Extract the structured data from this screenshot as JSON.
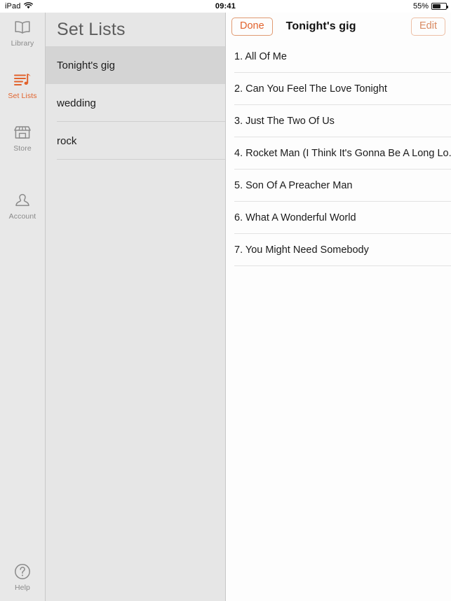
{
  "status_bar": {
    "device": "iPad",
    "wifi_icon": "wifi-icon",
    "time": "09:41",
    "battery_percent": "55%",
    "battery_level": 55
  },
  "colors": {
    "accent": "#e1622c",
    "edit_accent": "#d98a62",
    "rail_bg": "#e8e8e8",
    "mid_bg": "#e6e6e6",
    "mid_selected": "#d4d4d4",
    "detail_bg": "#fdfdfd"
  },
  "sidebar": {
    "items": [
      {
        "id": "library",
        "label": "Library",
        "icon": "book-icon",
        "active": false
      },
      {
        "id": "setlists",
        "label": "Set Lists",
        "icon": "setlist-icon",
        "active": true
      },
      {
        "id": "store",
        "label": "Store",
        "icon": "storefront-icon",
        "active": false
      },
      {
        "id": "account",
        "label": "Account",
        "icon": "person-icon",
        "active": false
      },
      {
        "id": "help",
        "label": "Help",
        "icon": "question-circle-icon",
        "active": false
      }
    ]
  },
  "set_lists_panel": {
    "title": "Set Lists",
    "items": [
      {
        "name": "Tonight's gig",
        "selected": true
      },
      {
        "name": "wedding",
        "selected": false
      },
      {
        "name": "rock",
        "selected": false
      }
    ]
  },
  "detail_panel": {
    "done_label": "Done",
    "edit_label": "Edit",
    "title": "Tonight's gig",
    "songs": [
      "1. All Of Me",
      "2. Can You Feel The Love Tonight",
      "3. Just The Two Of Us",
      "4. Rocket Man (I Think It's Gonna Be A Long Lo...",
      "5. Son Of A Preacher Man",
      "6. What A Wonderful World",
      "7. You Might Need Somebody"
    ]
  }
}
